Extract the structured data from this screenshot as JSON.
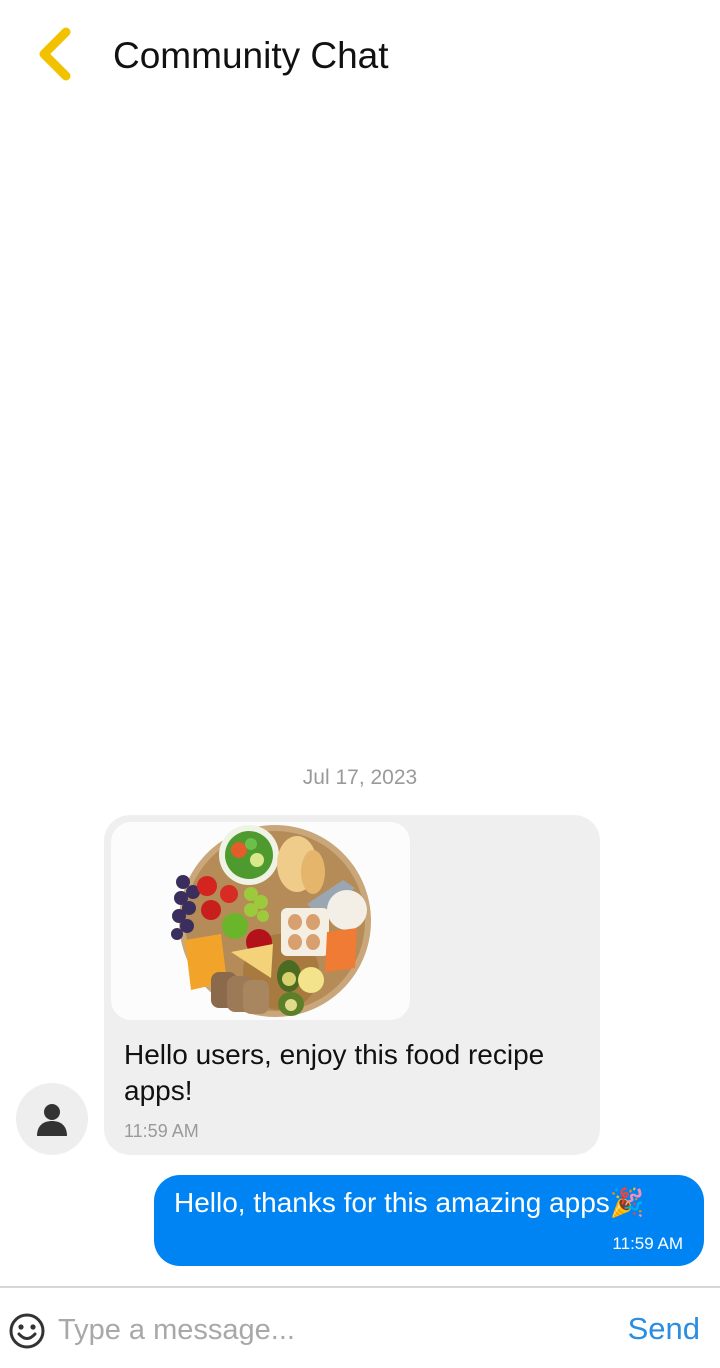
{
  "header": {
    "title": "Community Chat",
    "back_icon": "chevron-left-icon",
    "accent_color": "#f2c200"
  },
  "thread": {
    "date": "Jul 17, 2023",
    "incoming": {
      "avatar_icon": "user-icon",
      "image_icon": "food-plate-image",
      "text": "Hello users, enjoy this food recipe apps!",
      "time": "11:59 AM",
      "bubble_color": "#efefef"
    },
    "outgoing": {
      "text": "Hello, thanks for this amazing apps🎉",
      "time": "11:59 AM",
      "bubble_color": "#0084f4"
    }
  },
  "composer": {
    "emoji_icon": "smiley-icon",
    "placeholder": "Type a message...",
    "value": "",
    "send_label": "Send"
  }
}
